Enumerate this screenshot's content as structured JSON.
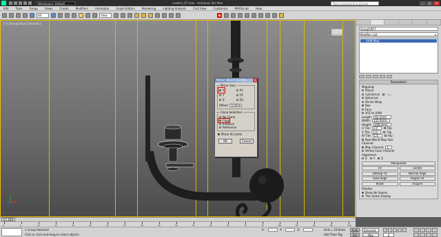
{
  "titlebar": {
    "workspace": "Workspace: Default",
    "doc_title": "Lantern_07.max - Autodesk 3ds Max",
    "search_placeholder": "Type a keyword or phrase"
  },
  "menus": [
    "Edit",
    "Tools",
    "Group",
    "Views",
    "Create",
    "Modifiers",
    "Animation",
    "Graph Editors",
    "Rendering",
    "Lighting Analysis",
    "Civil View",
    "Customize",
    "MAXScript",
    "Help"
  ],
  "toolbar": {
    "ref_coord": "View",
    "selection_filter": "All"
  },
  "viewport": {
    "label": "[+] [Perspective] [Realistic]"
  },
  "dialog": {
    "title": "Mirror: World Coordin...",
    "mirror_axis_label": "Mirror Axis:",
    "axes": [
      "X",
      "Y",
      "Z",
      "XY",
      "YZ",
      "ZX"
    ],
    "selected_axis": "X",
    "offset_label": "Offset:",
    "offset_value": "0.0mm",
    "clone_label": "Clone Selection:",
    "clone_options": [
      "No Clone",
      "Copy",
      "Instance",
      "Reference"
    ],
    "selected_clone": "Copy",
    "mirror_ik_label": "Mirror IK Limits",
    "ok": "OK",
    "cancel": "Cancel"
  },
  "cmdpanel": {
    "object_name": "Group5957",
    "modifier_list": "Modifier List",
    "stack_item": "UVW Map",
    "params_title": "Parameters",
    "mapping_label": "Mapping:",
    "mapping_options": [
      "Planar",
      "Cylindrical",
      "Spherical",
      "Shrink Wrap",
      "Box",
      "Face",
      "XYZ to UVW"
    ],
    "mapping_selected": "Box",
    "cap_label": "Cap",
    "length_label": "Length:",
    "length_value": "92.5mm",
    "width_label": "Width:",
    "width_value": "155.0mm",
    "height_label": "Height:",
    "height_value": "298.4mm",
    "utile_label": "U Tile:",
    "utile_value": "1.0",
    "vtile_label": "V Tile:",
    "vtile_value": "1.0",
    "wtile_label": "W Tile:",
    "wtile_value": "1.0",
    "flip_label": "Flip",
    "realworld_label": "Real-World Map Size",
    "channel_label": "Channel:",
    "map_channel_label": "Map Channel:",
    "map_channel_value": "1",
    "vertex_color_label": "Vertex Color Channel",
    "alignment_label": "Alignment:",
    "align_axes": [
      "X",
      "Y",
      "Z"
    ],
    "align_selected": "Z",
    "manipulate_label": "Manipulate",
    "buttons": [
      "Fit",
      "Center",
      "Bitmap Fit",
      "Normal Align",
      "View Align",
      "Region Fit",
      "Reset",
      "Acquire"
    ],
    "display_label": "Display:",
    "display_options": [
      "Show No Seams",
      "Thin Seam Display"
    ],
    "display_selected": "Show No Seams"
  },
  "timeline": {
    "frame_display": "0 / 100",
    "ticks": [
      "0",
      "5",
      "10",
      "15",
      "20",
      "25",
      "30",
      "35",
      "40",
      "45",
      "50",
      "55",
      "60",
      "65",
      "70",
      "75",
      "80",
      "85",
      "90",
      "95",
      "100"
    ]
  },
  "status": {
    "selected": "1 Group Selected",
    "prompt": "Click or click-and-drag to select objects",
    "x_label": "X:",
    "x_value": "",
    "y_label": "Y:",
    "y_value": "",
    "z_label": "Z:",
    "z_value": "",
    "grid": "Grid = 10.0mm",
    "time_tag": "Add Time Tag",
    "auto_key": "Auto Key",
    "set_key": "Set Key",
    "selection_set": "Selected",
    "key_filters": "Key Filters...",
    "frame": "0"
  }
}
